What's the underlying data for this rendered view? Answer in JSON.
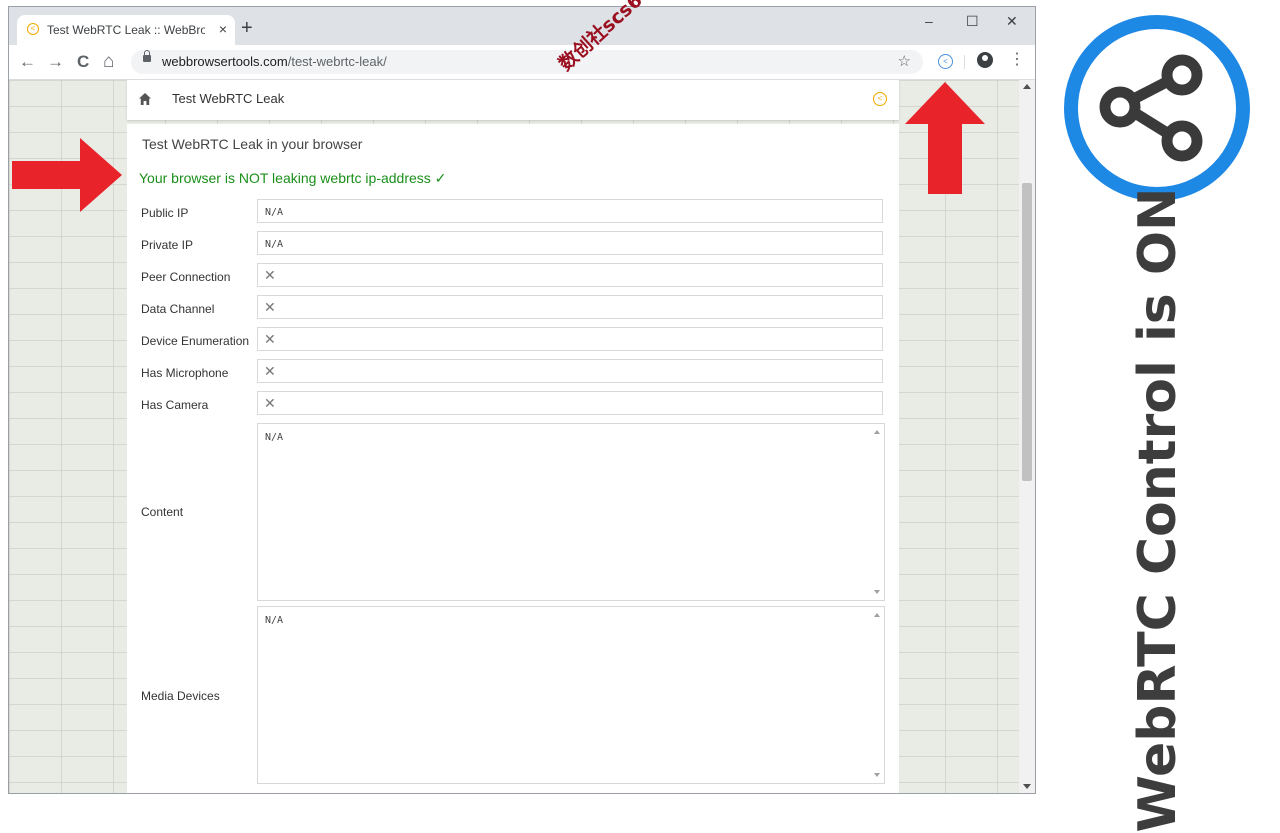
{
  "browser": {
    "tab_title": "Test WebRTC Leak :: WebBrowser",
    "tab_close": "×",
    "new_tab": "+",
    "window_controls": {
      "minimize": "–",
      "maximize": "☐",
      "close": "✕"
    },
    "nav": {
      "back": "←",
      "forward": "→",
      "reload": "C",
      "home": "⌂"
    },
    "url_domain": "webbrowsertools.com",
    "url_path": "/test-webrtc-leak/",
    "bookmark_star": "☆",
    "menu": "⋮"
  },
  "page": {
    "header_title": "Test WebRTC Leak",
    "content_title": "Test WebRTC Leak in your browser",
    "status_message": "Your browser is NOT leaking webrtc ip-address ✓",
    "status_color": "#1a8f1a",
    "rows": [
      {
        "label": "Public IP",
        "value": "N/A"
      },
      {
        "label": "Private IP",
        "value": "N/A"
      },
      {
        "label": "Peer Connection",
        "value": "✕"
      },
      {
        "label": "Data Channel",
        "value": "✕"
      },
      {
        "label": "Device Enumeration",
        "value": "✕"
      },
      {
        "label": "Has Microphone",
        "value": "✕"
      },
      {
        "label": "Has Camera",
        "value": "✕"
      }
    ],
    "content": {
      "label": "Content",
      "value": "N/A"
    },
    "media_devices": {
      "label": "Media Devices",
      "value": "N/A"
    }
  },
  "overlay": {
    "watermark": "数创社scs66",
    "arrow_color": "#e8232a",
    "side_caption": "WebRTC Control is ON",
    "badge_ring_color": "#1e88e5"
  }
}
